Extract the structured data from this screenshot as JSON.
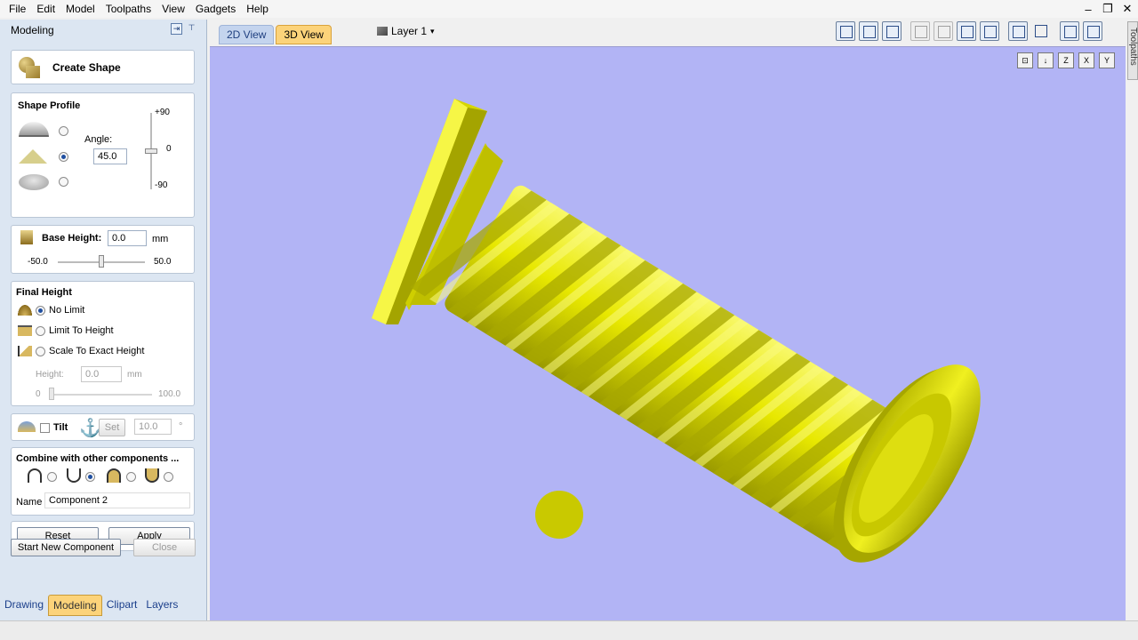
{
  "menu": [
    "File",
    "Edit",
    "Model",
    "Toolpaths",
    "View",
    "Gadgets",
    "Help"
  ],
  "window_controls": [
    "–",
    "❐",
    "✕"
  ],
  "left_panel": {
    "title": "Modeling",
    "create_shape": "Create Shape",
    "shape_profile": {
      "title": "Shape Profile",
      "angle_label": "Angle:",
      "angle_value": "45.0",
      "ticks": [
        "+90",
        "0",
        "-90"
      ],
      "selected_profile": 1
    },
    "base_height": {
      "label": "Base Height:",
      "value": "0.0",
      "unit": "mm",
      "min": "-50.0",
      "max": "50.0"
    },
    "final_height": {
      "title": "Final Height",
      "options": [
        "No Limit",
        "Limit To Height",
        "Scale To Exact Height"
      ],
      "selected": 0,
      "height_label": "Height:",
      "height_value": "0.0",
      "height_unit": "mm",
      "min": "0",
      "max": "100.0"
    },
    "tilt": {
      "label": "Tilt",
      "set_label": "Set",
      "value": "10.0",
      "unit": "°"
    },
    "combine": {
      "title": "Combine with other components ...",
      "selected": 1,
      "name_label": "Name",
      "name_value": "Component 2"
    },
    "buttons": {
      "reset": "Reset",
      "apply": "Apply",
      "start_new": "Start New Component",
      "close": "Close"
    }
  },
  "bottom_tabs": [
    "Drawing",
    "Modeling",
    "Clipart",
    "Layers"
  ],
  "view_tabs": [
    "2D View",
    "3D View"
  ],
  "layer_label": "Layer 1",
  "side_tab": "Toolpaths",
  "axis_buttons": [
    "⊡",
    "↓",
    "Z",
    "X",
    "Y"
  ],
  "colors": {
    "viewport_bg": "#b2b4f5",
    "model_yellow": "#e6e600",
    "active_tab": "#fcd37a"
  }
}
